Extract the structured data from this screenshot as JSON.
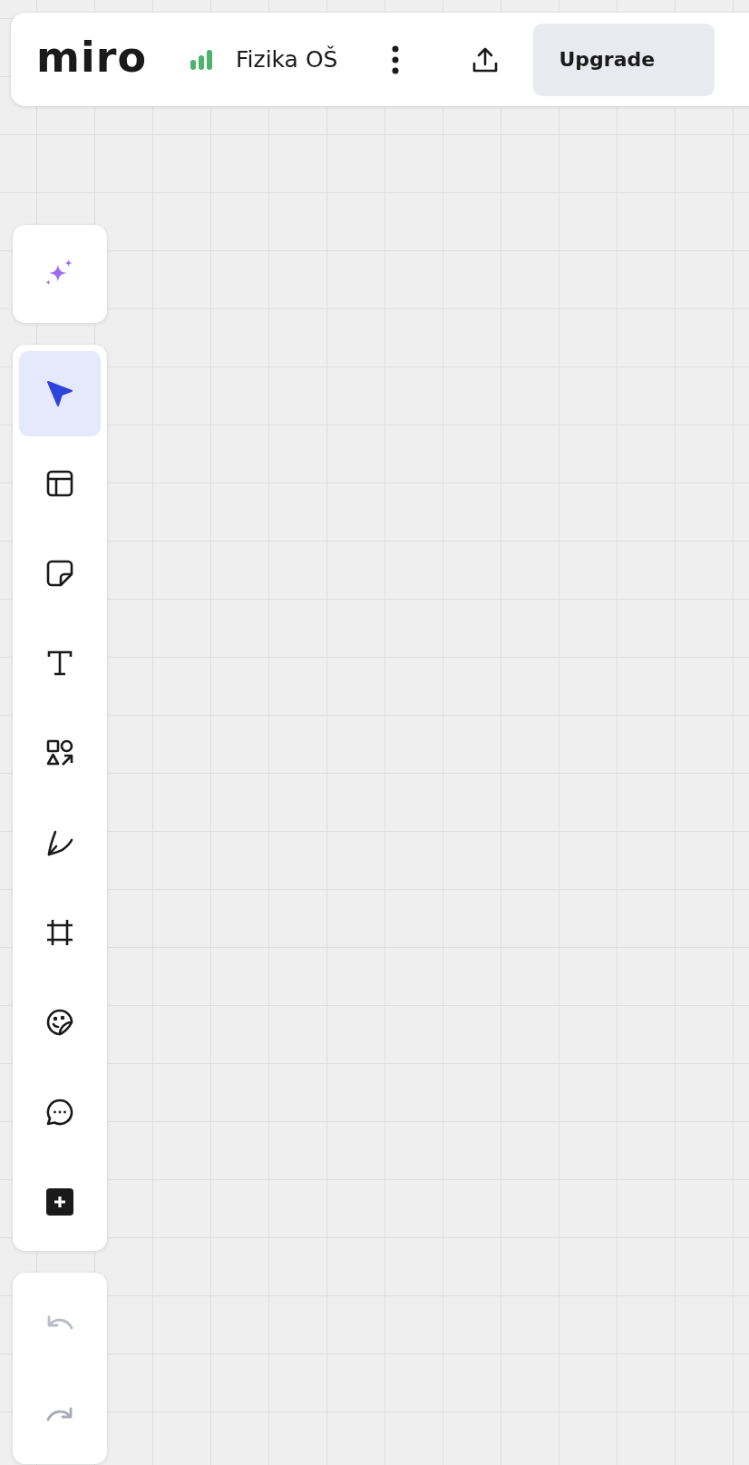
{
  "topbar": {
    "logo": "miro",
    "board_name": "Fizika OŠ",
    "upgrade_button": "Upgrade"
  },
  "ai_button": {
    "kind": "sparkle"
  },
  "tools": [
    {
      "kind": "select",
      "selected": true
    },
    {
      "kind": "templates",
      "selected": false
    },
    {
      "kind": "sticky",
      "selected": false
    },
    {
      "kind": "text",
      "selected": false
    },
    {
      "kind": "shapes",
      "selected": false
    },
    {
      "kind": "pen",
      "selected": false
    },
    {
      "kind": "frame",
      "selected": false
    },
    {
      "kind": "sticker",
      "selected": false
    },
    {
      "kind": "comment",
      "selected": false
    },
    {
      "kind": "more",
      "selected": false
    }
  ],
  "history": [
    {
      "kind": "undo",
      "disabled": true
    },
    {
      "kind": "redo",
      "disabled": true
    }
  ]
}
